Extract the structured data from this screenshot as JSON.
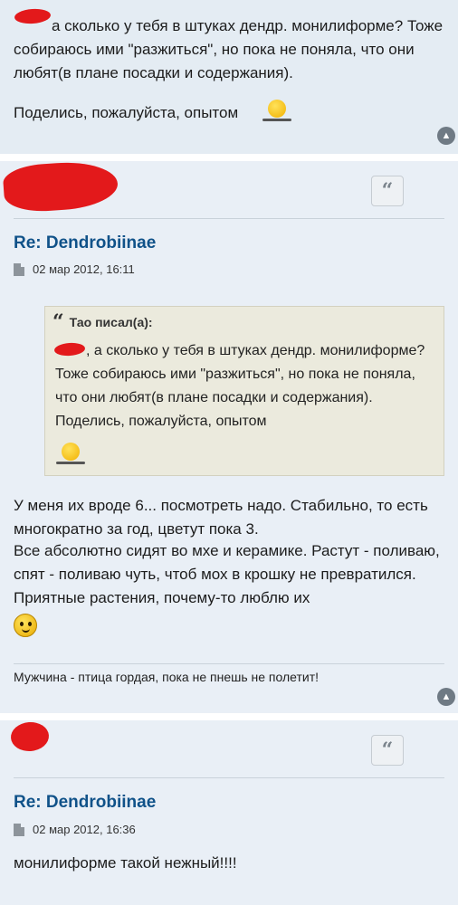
{
  "post_top": {
    "quote_body": "а сколько у тебя в штуках дендр. монилиформе? Тоже собираюсь ими \"разжиться\", но пока не поняла, что они любят(в плане посадки и содержания).",
    "quote_tail": "Поделись, пожалуйста, опытом",
    "smiley": "sun-smiley-icon"
  },
  "post_main": {
    "title": "Re: Dendrobiinae",
    "date": "02 мар 2012, 16:11",
    "quote": {
      "author": "Тао писал(а):",
      "text": ", а сколько у тебя в штуках дендр. монилиформе? Тоже собираюсь ими \"разжиться\", но пока не поняла, что они любят(в плане посадки и содержания). Поделись, пожалуйста, опытом"
    },
    "body_line_1": "У меня их вроде 6... посмотреть надо. Стабильно, то есть многократно за год, цветут пока 3.",
    "body_line_2": "Все абсолютно сидят во мхе и керамике. Растут - поливаю, спят - поливаю чуть, чтоб мох в крошку не превратился. Приятные растения, почему-то люблю их",
    "signature": "Мужчина - птица гордая, пока не пнешь не полетит!"
  },
  "post_bottom": {
    "title": "Re: Dendrobiinae",
    "date": "02 мар 2012, 16:36",
    "body": "монилиформе такой нежный!!!!"
  },
  "icons": {
    "quote": "quote-icon",
    "scroll_top": "chevron-up-icon",
    "post": "document-icon"
  },
  "colors": {
    "title": "#105289",
    "redaction": "#e3191b",
    "post_background": "#e9eff6",
    "quote_background": "#ebeadd"
  }
}
